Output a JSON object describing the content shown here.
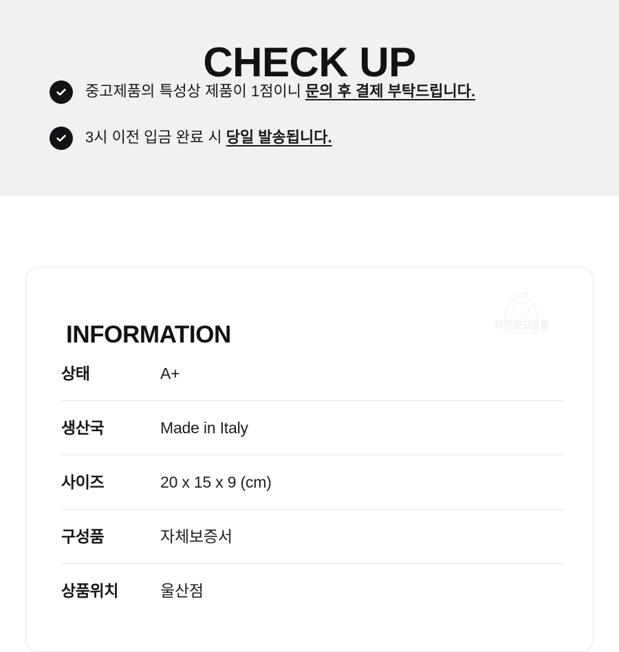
{
  "checkup": {
    "title": "CHECK UP",
    "background_color": "#f0f1f3",
    "icon_color": "#121316",
    "items": [
      {
        "icon": "check-circle-icon",
        "text_plain": "중고제품의 특성상 제품이 1점이니 ",
        "text_emphasis": "문의 후 결제 부탁드립니다."
      },
      {
        "icon": "check-circle-icon",
        "text_plain": "3시 이전 입금 완료 시 ",
        "text_emphasis": "당일 발송됩니다."
      }
    ]
  },
  "information": {
    "heading": "INFORMATION",
    "watermark": {
      "icon": "watch-clock-icon",
      "name": "착한중고명품",
      "sub": "LUXURY GOODS"
    },
    "rows": [
      {
        "label": "상태",
        "value": "A+"
      },
      {
        "label": "생산국",
        "value": "Made in Italy"
      },
      {
        "label": "사이즈",
        "value": "20 x 15 x 9 (cm)"
      },
      {
        "label": "구성품",
        "value": "자체보증서"
      },
      {
        "label": "상품위치",
        "value": "울산점"
      }
    ]
  },
  "colors": {
    "band_background": "#f0f1f3",
    "page_background": "#ffffff",
    "text_primary": "#111214",
    "divider": "#e4e4e6",
    "card_border": "#e7e7e9"
  }
}
